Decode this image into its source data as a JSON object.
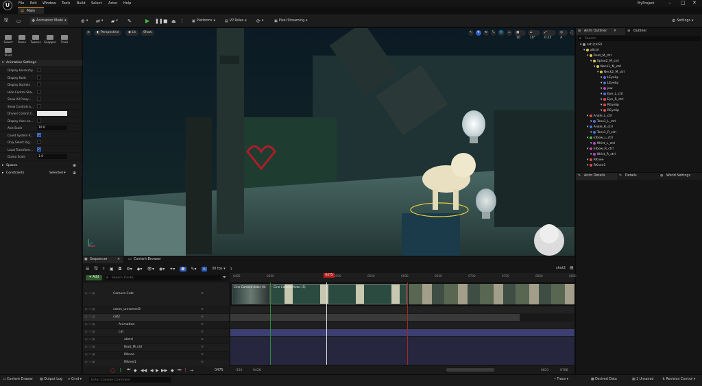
{
  "menubar": {
    "logo": "U",
    "items": [
      "File",
      "Edit",
      "Window",
      "Tools",
      "Build",
      "Select",
      "Actor",
      "Help"
    ],
    "project": "MyProject"
  },
  "level_tab": "Main",
  "toolbar": {
    "mode": "Animation Mode",
    "platforms": "Platforms",
    "vp_roles": "VP Roles",
    "pixel_streaming": "Pixel Streaming",
    "settings": "Settings"
  },
  "tools": [
    "Select",
    "Poses",
    "Tweens",
    "Snapper",
    "Trails",
    "Pivot"
  ],
  "animation_settings": {
    "header": "Animation Settings",
    "rows": [
      {
        "label": "Display Hierarchy",
        "type": "check",
        "value": false
      },
      {
        "label": "Display Nulls",
        "type": "check",
        "value": false
      },
      {
        "label": "Display Sockets",
        "type": "check",
        "value": false
      },
      {
        "label": "Hide Control Sha...",
        "type": "check",
        "value": false
      },
      {
        "label": "Show All Proxy...",
        "type": "check",
        "value": false
      },
      {
        "label": "Show Controls a...",
        "type": "check",
        "value": false
      },
      {
        "label": "Drivers Control C...",
        "type": "color",
        "value": ""
      },
      {
        "label": "Display Axes on...",
        "type": "check",
        "value": false
      },
      {
        "label": "Axis Scale",
        "type": "number",
        "value": "10.0"
      },
      {
        "label": "Coord System P...",
        "type": "check",
        "value": true
      },
      {
        "label": "Only Select Rig...",
        "type": "check",
        "value": false
      },
      {
        "label": "Local Transform...",
        "type": "check",
        "value": true
      },
      {
        "label": "Gizmo Scale",
        "type": "number",
        "value": "1.0"
      }
    ],
    "spaces": "Spaces",
    "constraints": "Constraints",
    "constraints_value": "Selected"
  },
  "viewport": {
    "perspective": "Perspective",
    "lit": "Lit",
    "show": "Show",
    "snap_translate": "10",
    "snap_rotate": "10°",
    "snap_scale": "0.25",
    "camera_speed": "4"
  },
  "outliner": {
    "tabs": [
      "Anim Outliner",
      "Outliner"
    ],
    "search_placeholder": "Search",
    "items": [
      {
        "label": "cat (cat2)",
        "depth": 0,
        "color": "#9a9a9a"
      },
      {
        "label": "allctrl",
        "depth": 1,
        "color": "#e0c84a"
      },
      {
        "label": "Root_M_ctrl",
        "depth": 2,
        "color": "#e0c84a"
      },
      {
        "label": "Spine2_M_ctrl",
        "depth": 3,
        "color": "#e0c84a"
      },
      {
        "label": "Neck1_M_ctrl",
        "depth": 4,
        "color": "#e0c84a"
      },
      {
        "label": "Neck2_M_ctrl",
        "depth": 5,
        "color": "#e0c84a"
      },
      {
        "label": "LEyelip",
        "depth": 6,
        "color": "#4a6fe0"
      },
      {
        "label": "LEyelip",
        "depth": 6,
        "color": "#4a6fe0"
      },
      {
        "label": "jaw",
        "depth": 6,
        "color": "#c040c0"
      },
      {
        "label": "Eye_L_ctrl",
        "depth": 6,
        "color": "#4a6fe0"
      },
      {
        "label": "Eye_R_ctrl",
        "depth": 6,
        "color": "#e04a4a"
      },
      {
        "label": "REyelip",
        "depth": 6,
        "color": "#e04a4a"
      },
      {
        "label": "REyelip",
        "depth": 6,
        "color": "#e04a4a"
      },
      {
        "label": "Ankle_L_ctrl",
        "depth": 2,
        "color": "#e04a4a"
      },
      {
        "label": "Toes1_L_ctrl",
        "depth": 3,
        "color": "#4a6fe0"
      },
      {
        "label": "Ankle_R_ctrl",
        "depth": 2,
        "color": "#4a6fe0"
      },
      {
        "label": "Toes1_R_ctrl",
        "depth": 3,
        "color": "#4a6fe0"
      },
      {
        "label": "Elbow_L_ctrl",
        "depth": 2,
        "color": "#40c040"
      },
      {
        "label": "Wrist_L_ctrl",
        "depth": 3,
        "color": "#c040c0"
      },
      {
        "label": "Elbow_R_ctrl",
        "depth": 2,
        "color": "#c040c0"
      },
      {
        "label": "Wrist_R_ctrl",
        "depth": 3,
        "color": "#c040c0"
      },
      {
        "label": "RKnee",
        "depth": 2,
        "color": "#e04a4a"
      },
      {
        "label": "RKnee1",
        "depth": 2,
        "color": "#e04a4a"
      }
    ],
    "details_tabs": [
      "Anim Details",
      "Details",
      "World Settings"
    ]
  },
  "sequencer": {
    "tabs": [
      "Sequencer",
      "Content Browser"
    ],
    "add_label": "+ Add",
    "search_placeholder": "Search Tracks",
    "fps": "30 fps",
    "sequence_name": "shot2",
    "current_frame": "0475",
    "playhead_label": "0475",
    "camera_cuts_label": "Camera Cuts",
    "clip_labels": [
      "Cine Camera Actor (4)",
      "Cine Camera Actor (5)"
    ],
    "tracks": [
      {
        "label": "Camera Cuts",
        "indent": 0
      },
      {
        "label": "cases_unnamed3",
        "indent": 0
      },
      {
        "label": "cat2",
        "indent": 0
      },
      {
        "label": "Animation",
        "indent": 1
      },
      {
        "label": "cat",
        "indent": 1
      },
      {
        "label": "allctrl",
        "indent": 2
      },
      {
        "label": "Root_M_ctrl",
        "indent": 2
      },
      {
        "label": "RKnee",
        "indent": 2
      },
      {
        "label": "RKnee1",
        "indent": 2
      }
    ],
    "ruler_ticks": [
      "0405",
      "0450",
      "0475",
      "0500",
      "0550",
      "0600",
      "0650",
      "0700",
      "0750",
      "0800",
      "0850"
    ],
    "range_start": "-350",
    "range_current": "0426",
    "range_end_a": "0821",
    "range_end_b": "0788"
  },
  "statusbar": {
    "content_drawer": "Content Drawer",
    "output_log": "Output Log",
    "cmd": "Cmd",
    "console_placeholder": "Enter Console Command",
    "trace": "Trace",
    "derived_data": "Derived Data",
    "unsaved": "1 Unsaved",
    "revision_control": "Revision Control"
  }
}
